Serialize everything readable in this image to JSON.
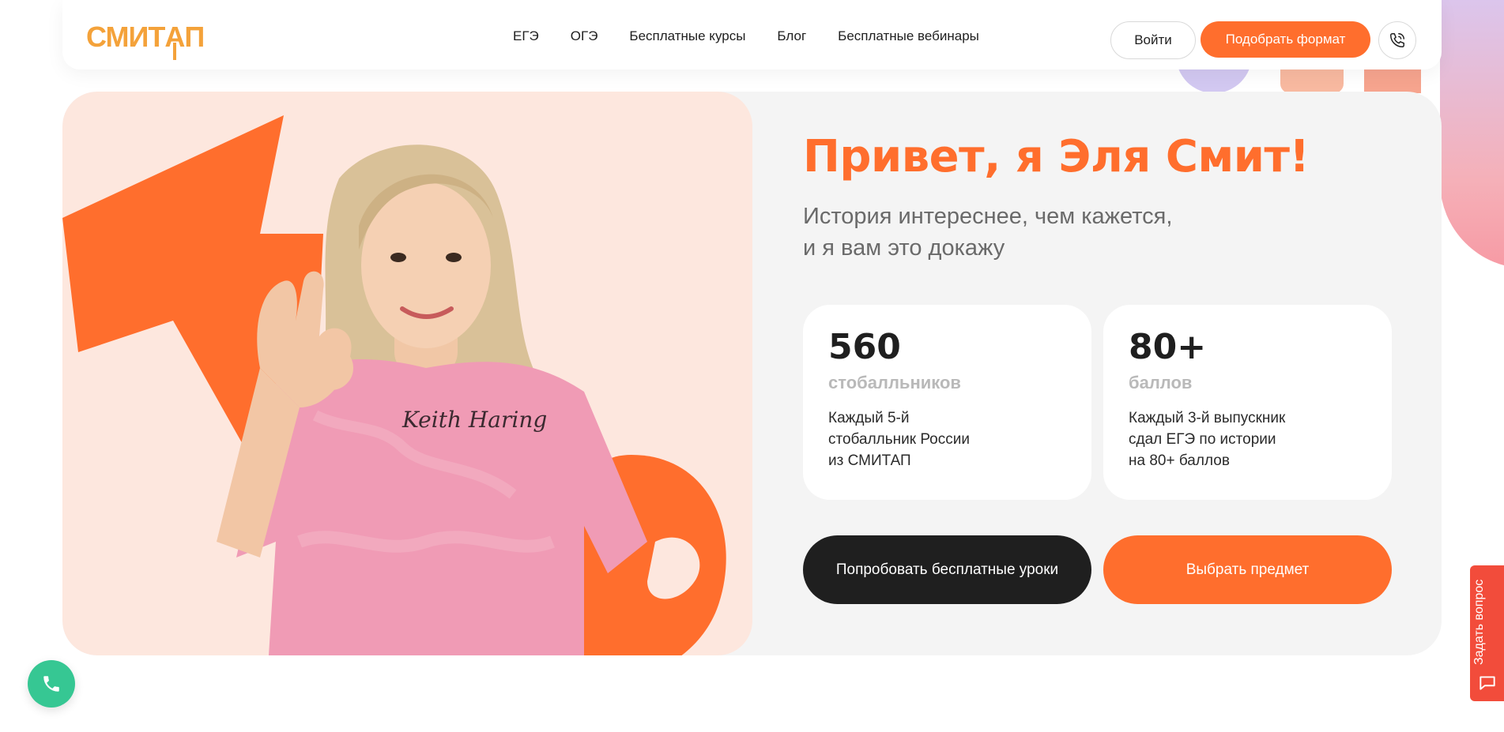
{
  "brand": {
    "logo_text_left": "СМИТ",
    "logo_text_up": "А",
    "logo_text_right": "П"
  },
  "colors": {
    "accent": "#ff6e2d",
    "logo": "#f4a23a",
    "dark": "#1f1f1f",
    "fab": "#36c793",
    "ask_tab": "#f24c3b"
  },
  "nav": {
    "items": [
      "ЕГЭ",
      "ОГЭ",
      "Бесплатные курсы",
      "Блог",
      "Бесплатные вебинары"
    ]
  },
  "header": {
    "login_label": "Войти",
    "format_label": "Подобрать формат",
    "phone_icon": "phone-icon"
  },
  "hero": {
    "title": "Привет, я Эля Смит!",
    "subtitle_line1": "История интереснее, чем кажется,",
    "subtitle_line2": "и я вам это докажу",
    "photo_text": "Keith Haring"
  },
  "stats": [
    {
      "value": "560",
      "label": "стобалльников",
      "desc_lines": [
        "Каждый 5-й",
        "стобалльник России",
        "из СМИТАП"
      ]
    },
    {
      "value": "80+",
      "label": "баллов",
      "desc_lines": [
        "Каждый 3-й выпускник",
        "сдал ЕГЭ по истории",
        "на 80+ баллов"
      ]
    }
  ],
  "cta": {
    "free_lessons": "Попробовать бесплатные уроки",
    "choose_subject": "Выбрать предмет"
  },
  "floating": {
    "ask_question": "Задать вопрос",
    "call_icon": "phone-icon"
  }
}
